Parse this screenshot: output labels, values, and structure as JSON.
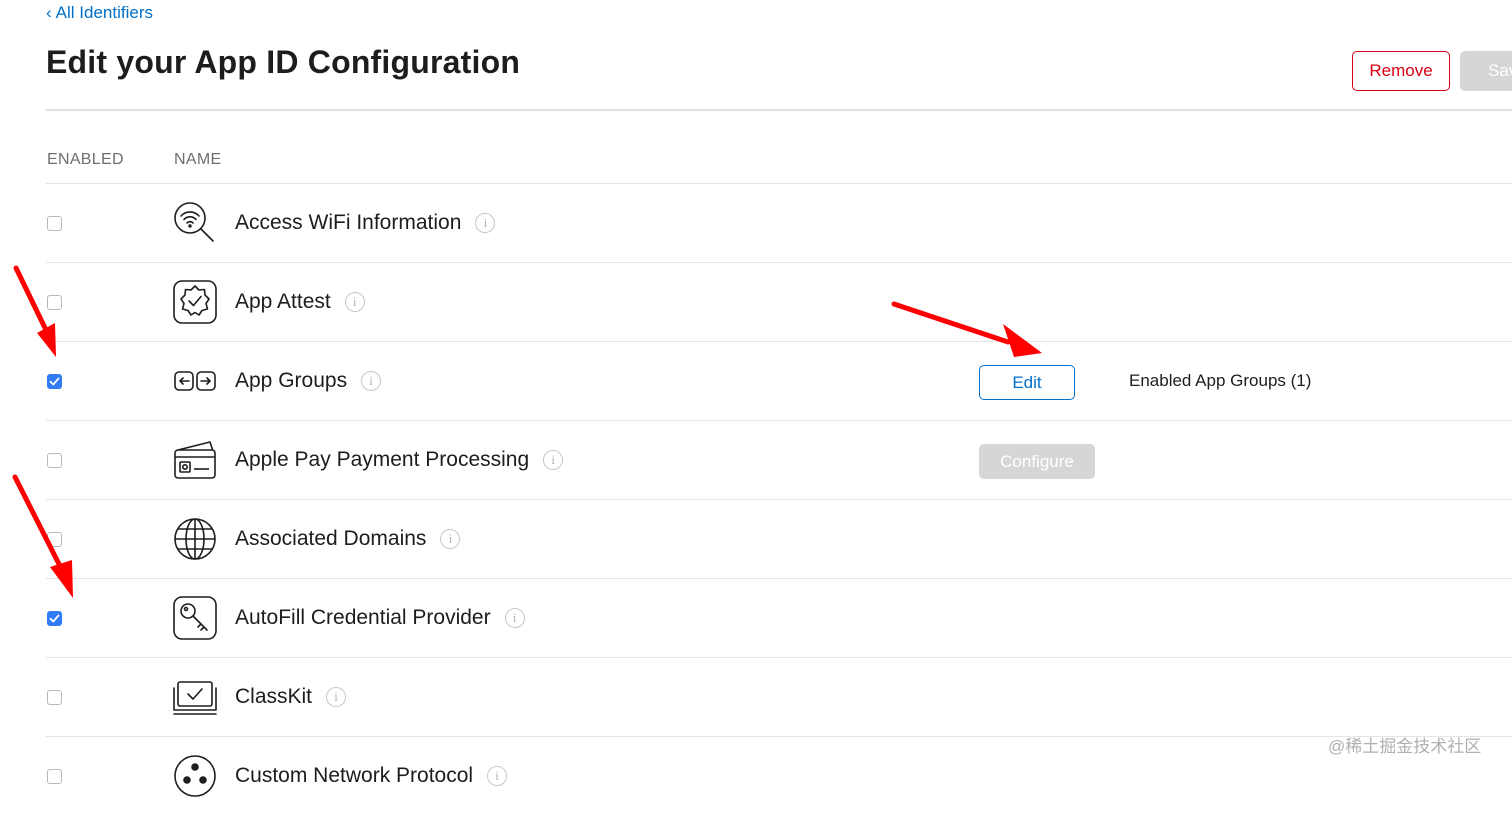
{
  "nav": {
    "back_link": "All Identifiers"
  },
  "page": {
    "title": "Edit your App ID Configuration"
  },
  "actions": {
    "remove_label": "Remove",
    "save_label": "Save"
  },
  "table": {
    "col_enabled": "ENABLED",
    "col_name": "NAME",
    "rows": [
      {
        "name": "Access WiFi Information",
        "enabled": false,
        "icon": "wifi-search-icon"
      },
      {
        "name": "App Attest",
        "enabled": false,
        "icon": "badge-check-icon"
      },
      {
        "name": "App Groups",
        "enabled": true,
        "icon": "app-groups-icon",
        "action_label": "Edit",
        "note": "Enabled App Groups (1)"
      },
      {
        "name": "Apple Pay Payment Processing",
        "enabled": false,
        "icon": "credit-card-icon",
        "action_label": "Configure"
      },
      {
        "name": "Associated Domains",
        "enabled": false,
        "icon": "globe-icon"
      },
      {
        "name": "AutoFill Credential Provider",
        "enabled": true,
        "icon": "key-icon"
      },
      {
        "name": "ClassKit",
        "enabled": false,
        "icon": "classkit-icon"
      },
      {
        "name": "Custom Network Protocol",
        "enabled": false,
        "icon": "network-protocol-icon"
      }
    ]
  },
  "watermark": "@稀土掘金技术社区",
  "colors": {
    "accent": "#0070c9",
    "danger": "#d70015",
    "checkbox": "#2f7cf6",
    "annotation": "#ff0000",
    "disabled": "#d6d6d6"
  }
}
